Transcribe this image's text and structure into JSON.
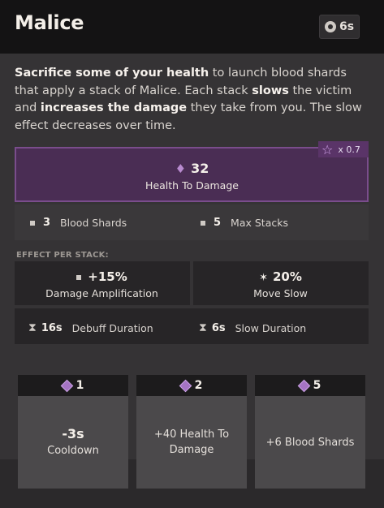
{
  "header": {
    "title": "Malice",
    "cooldown_chip": "6s",
    "cooldown_icon": "cooldown-clock-icon"
  },
  "description": {
    "seg1_bold": "Sacrifice some of your health",
    "seg2": " to launch blood shards that apply a stack of Malice. Each stack ",
    "seg3_bold": "slows",
    "seg4": " the victim and ",
    "seg5_bold": "increases the damage",
    "seg6": " they take from you. The slow effect decreases over time."
  },
  "hero": {
    "value": "32",
    "label": "Health To Damage",
    "badge_multiplier": "x 0.7",
    "icon": "blood-drop-icon",
    "accent": "#4a2d54"
  },
  "stats": [
    {
      "value": "3",
      "label": "Blood Shards"
    },
    {
      "value": "5",
      "label": "Max Stacks"
    }
  ],
  "effect_per_stack": {
    "title": "EFFECT PER STACK:",
    "damage_amp": {
      "value": "+15%",
      "label": "Damage Amplification"
    },
    "move_slow": {
      "value": "20%",
      "label": "Move Slow"
    },
    "debuff": {
      "value": "16s",
      "label": "Debuff Duration"
    },
    "slow_dur": {
      "value": "6s",
      "label": "Slow Duration"
    }
  },
  "upgrades": [
    {
      "cost": "1",
      "main": "-3s",
      "sub": "Cooldown"
    },
    {
      "cost": "2",
      "text": "+40 Health To Damage"
    },
    {
      "cost": "5",
      "text": "+6 Blood Shards"
    }
  ],
  "colors": {
    "upgrade_diamond": "#a574c4",
    "header_bg": "#141314"
  }
}
